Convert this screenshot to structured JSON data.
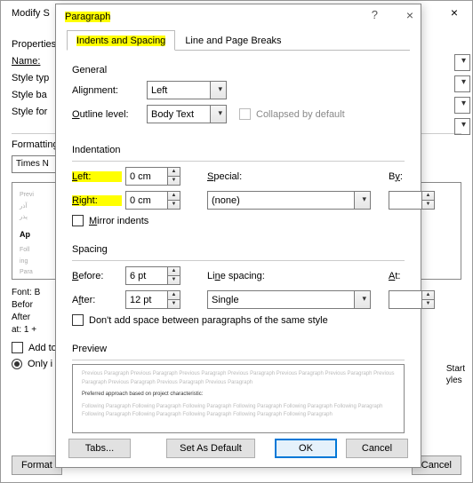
{
  "bg": {
    "title": "Modify S",
    "properties_label": "Properties",
    "name_label": "Name:",
    "style_type_label": "Style typ",
    "style_base_label": "Style ba",
    "style_for_label": "Style for",
    "formatting_label": "Formatting",
    "font_value": "Times N",
    "preview_prev": "Previ\nآذر\nپذر",
    "preview_ap": "Ap",
    "preview_foll": "Foll\ning\nPara\nآذر\nFoll\ning",
    "summary": "Font: B\nBefor\nAfter\nat: 1 +",
    "add_to": "Add to",
    "only_i": "Only i",
    "format_btn": "Format",
    "cancel_btn": "Cancel",
    "start_yles": "Start\nyles"
  },
  "paragraph": {
    "title": "Paragraph",
    "tabs": {
      "indents": "Indents and Spacing",
      "linebreaks": "Line and Page Breaks"
    },
    "general": {
      "heading": "General",
      "alignment_label": "Alignment:",
      "alignment_value": "Left",
      "outline_label": "Outline level:",
      "outline_value": "Body Text",
      "collapsed_label": "Collapsed by default"
    },
    "indentation": {
      "heading": "Indentation",
      "left_label": "Left:",
      "left_value": "0 cm",
      "right_label": "Right:",
      "right_value": "0 cm",
      "special_label": "Special:",
      "special_value": "(none)",
      "by_label": "By:",
      "by_value": "",
      "mirror_label": "Mirror indents"
    },
    "spacing": {
      "heading": "Spacing",
      "before_label": "Before:",
      "before_value": "6 pt",
      "after_label": "After:",
      "after_value": "12 pt",
      "line_label": "Line spacing:",
      "line_value": "Single",
      "at_label": "At:",
      "at_value": "",
      "noadd_label": "Don't add space between paragraphs of the same style"
    },
    "preview": {
      "heading": "Preview",
      "prev_line": "Previous Paragraph Previous Paragraph Previous Paragraph Previous Paragraph Previous Paragraph Previous Paragraph Previous Paragraph Previous Paragraph Previous Paragraph Previous Paragraph",
      "mid_line": "Preferred approach based on project characteristic:",
      "foll_line": "Following Paragraph Following Paragraph Following Paragraph Following Paragraph Following Paragraph Following Paragraph Following Paragraph Following Paragraph Following Paragraph Following Paragraph Following Paragraph"
    },
    "buttons": {
      "tabs": "Tabs...",
      "default": "Set As Default",
      "ok": "OK",
      "cancel": "Cancel"
    }
  }
}
